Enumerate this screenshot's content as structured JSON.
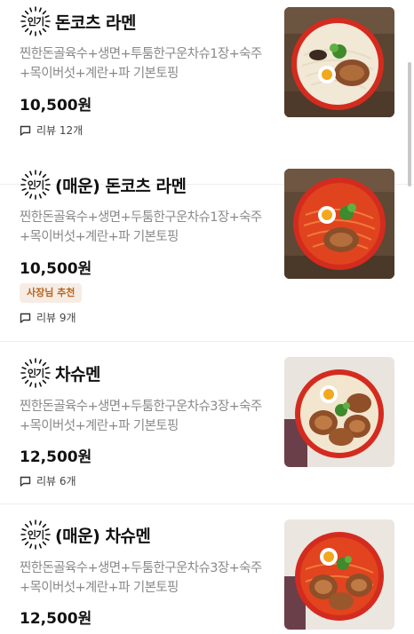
{
  "menu": {
    "items": [
      {
        "badge": "인기",
        "name": "돈코츠 라멘",
        "description": "찐한돈골육수+생면+투툼한구운차슈1장+숙주+목이버섯+계란+파 기본토핑",
        "price": "10,500원",
        "tag": "",
        "reviews": "리뷰 12개",
        "image": "white-tonkotsu-ramen"
      },
      {
        "badge": "인기",
        "name": "(매운) 돈코츠 라멘",
        "description": "찐한돈골육수+생면+두툼한구운차슈1장+숙주+목이버섯+계란+파 기본토핑",
        "price": "10,500원",
        "tag": "사장님 추천",
        "reviews": "리뷰 9개",
        "image": "spicy-red-ramen"
      },
      {
        "badge": "인기",
        "name": "차슈멘",
        "description": "찐한돈골육수+생면+두툼한구운차슈3장+숙주+목이버섯+계란+파 기본토핑",
        "price": "12,500원",
        "tag": "",
        "reviews": "리뷰 6개",
        "image": "chashu-ramen"
      },
      {
        "badge": "인기",
        "name": "(매운) 차슈멘",
        "description": "찐한돈골육수+생면+두툼한구운차슈3장+숙주+목이버섯+계란+파 기본토핑",
        "price": "12,500원",
        "tag": "",
        "reviews": "",
        "image": "spicy-chashu-ramen"
      }
    ]
  },
  "colors": {
    "tag_bg": "#f7ece4",
    "tag_text": "#b5641e",
    "bowl": "#d42b1f"
  }
}
